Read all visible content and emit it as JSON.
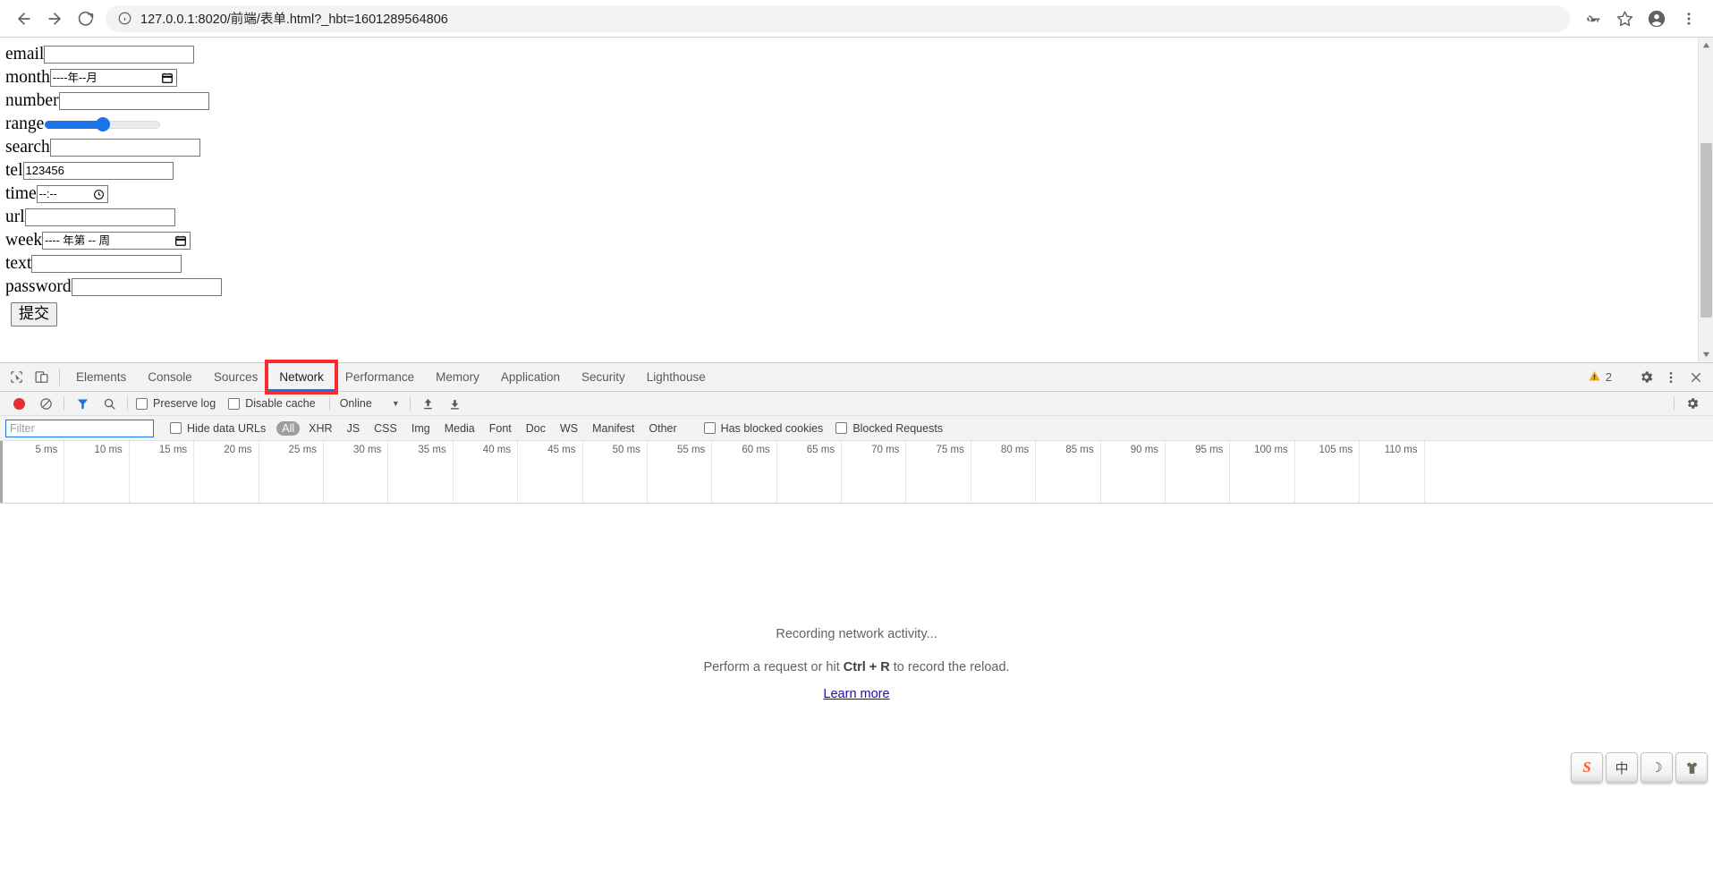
{
  "browser": {
    "nav": {
      "back": "back-arrow",
      "forward": "forward-arrow",
      "reload": "reload"
    },
    "url": "127.0.0.1:8020/前端/表单.html?_hbt=1601289564806",
    "toolbar_right": [
      "key-icon",
      "star-icon",
      "profile-icon",
      "menu-icon"
    ]
  },
  "form": {
    "fields": [
      {
        "label": "email",
        "type": "email",
        "value": "",
        "placeholder": ""
      },
      {
        "label": "month",
        "type": "month",
        "value": "",
        "placeholder": "----年--月"
      },
      {
        "label": "number",
        "type": "number",
        "value": "",
        "placeholder": ""
      },
      {
        "label": "range",
        "type": "range",
        "value": "50",
        "placeholder": ""
      },
      {
        "label": "search",
        "type": "search",
        "value": "",
        "placeholder": ""
      },
      {
        "label": "tel",
        "type": "tel",
        "value": "123456",
        "placeholder": ""
      },
      {
        "label": "time",
        "type": "time",
        "value": "",
        "placeholder": "--:--"
      },
      {
        "label": "url",
        "type": "url",
        "value": "",
        "placeholder": ""
      },
      {
        "label": "week",
        "type": "week",
        "value": "",
        "placeholder": "---- 年第 -- 周"
      },
      {
        "label": "text",
        "type": "text",
        "value": "",
        "placeholder": ""
      },
      {
        "label": "password",
        "type": "password",
        "value": "",
        "placeholder": ""
      }
    ],
    "submit_label": "提交"
  },
  "devtools": {
    "left_icons": [
      "inspect-element-icon",
      "device-toolbar-icon"
    ],
    "tabs": [
      {
        "label": "Elements",
        "active": false
      },
      {
        "label": "Console",
        "active": false
      },
      {
        "label": "Sources",
        "active": false
      },
      {
        "label": "Network",
        "active": true
      },
      {
        "label": "Performance",
        "active": false
      },
      {
        "label": "Memory",
        "active": false
      },
      {
        "label": "Application",
        "active": false
      },
      {
        "label": "Security",
        "active": false
      },
      {
        "label": "Lighthouse",
        "active": false
      }
    ],
    "warning_count": "2",
    "right_icons": [
      "warning-icon",
      "settings-gear-icon",
      "more-options-icon",
      "close-icon"
    ],
    "network_toolbar": {
      "record_state": "recording",
      "clear_label": "clear-icon",
      "filter_icon": "filter-funnel-icon",
      "search_icon": "search-icon",
      "preserve_log": {
        "label": "Preserve log",
        "checked": false
      },
      "disable_cache": {
        "label": "Disable cache",
        "checked": false
      },
      "throttle": "Online",
      "import_icon": "import-har-icon",
      "export_icon": "export-har-icon",
      "settings_icon": "network-settings-gear-icon"
    },
    "filter_toolbar": {
      "filter_placeholder": "Filter",
      "filter_value": "",
      "hide_data_urls": {
        "label": "Hide data URLs",
        "checked": false
      },
      "types": [
        "All",
        "XHR",
        "JS",
        "CSS",
        "Img",
        "Media",
        "Font",
        "Doc",
        "WS",
        "Manifest",
        "Other"
      ],
      "selected_type": "All",
      "has_blocked_cookies": {
        "label": "Has blocked cookies",
        "checked": false
      },
      "blocked_requests": {
        "label": "Blocked Requests",
        "checked": false
      }
    },
    "timeline_ticks": [
      "5 ms",
      "10 ms",
      "15 ms",
      "20 ms",
      "25 ms",
      "30 ms",
      "35 ms",
      "40 ms",
      "45 ms",
      "50 ms",
      "55 ms",
      "60 ms",
      "65 ms",
      "70 ms",
      "75 ms",
      "80 ms",
      "85 ms",
      "90 ms",
      "95 ms",
      "100 ms",
      "105 ms",
      "110 ms"
    ],
    "empty_state": {
      "line1": "Recording network activity...",
      "line2_prefix": "Perform a request or hit ",
      "line2_shortcut": "Ctrl + R",
      "line2_suffix": " to record the reload.",
      "link": "Learn more"
    }
  },
  "ime": {
    "keys": [
      {
        "name": "sogou-logo-icon",
        "glyph": "S"
      },
      {
        "name": "chinese-mode-icon",
        "glyph": "中"
      },
      {
        "name": "moon-icon",
        "glyph": "☽"
      },
      {
        "name": "skin-icon",
        "glyph": "👕"
      }
    ]
  },
  "colors": {
    "accent": "#1a73e8",
    "annotation": "#fb2c2c",
    "record": "#e13030",
    "link": "#1a0dab",
    "warning": "#f5a623"
  }
}
